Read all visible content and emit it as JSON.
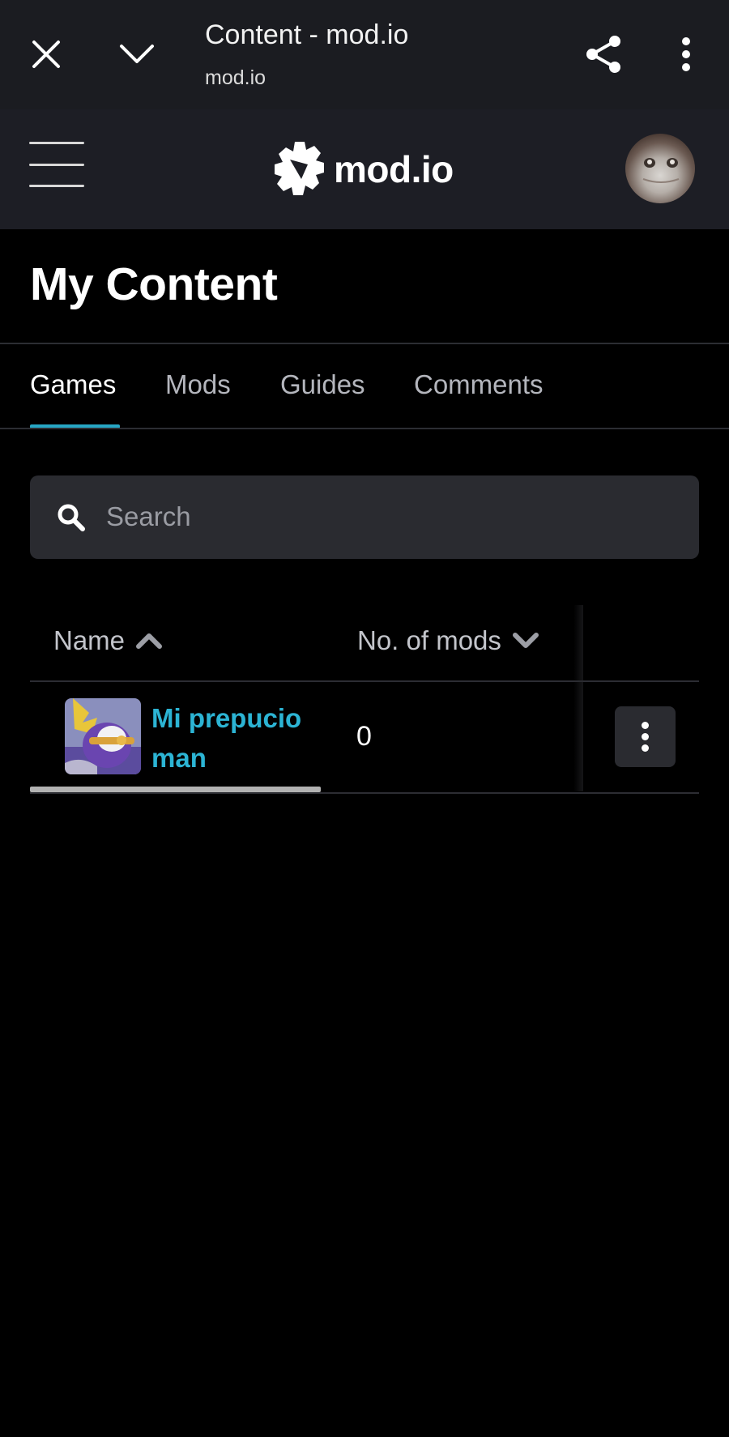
{
  "browser": {
    "title": "Content - mod.io",
    "url": "mod.io",
    "close_icon": "close-icon",
    "collapse_icon": "chevron-down-icon",
    "share_icon": "share-icon",
    "menu_icon": "more-vertical-icon"
  },
  "header": {
    "logo_text": "mod.io",
    "menu_icon": "hamburger-icon",
    "avatar_alt": "user avatar"
  },
  "page": {
    "title": "My Content"
  },
  "tabs": [
    {
      "label": "Games",
      "active": true
    },
    {
      "label": "Mods",
      "active": false
    },
    {
      "label": "Guides",
      "active": false
    },
    {
      "label": "Comments",
      "active": false
    }
  ],
  "search": {
    "placeholder": "Search",
    "value": ""
  },
  "table": {
    "columns": [
      {
        "label": "Name",
        "sort": "ascending"
      },
      {
        "label": "No. of mods",
        "sort": "descending"
      }
    ],
    "rows": [
      {
        "name": "Mi prepucio man",
        "mods": "0"
      }
    ]
  },
  "colors": {
    "accent": "#27a6c4",
    "link": "#2cb4d4",
    "background": "#000000",
    "header_bg": "#1d1e25",
    "browser_bar_bg": "#1b1c21",
    "input_bg": "#2a2b30"
  }
}
